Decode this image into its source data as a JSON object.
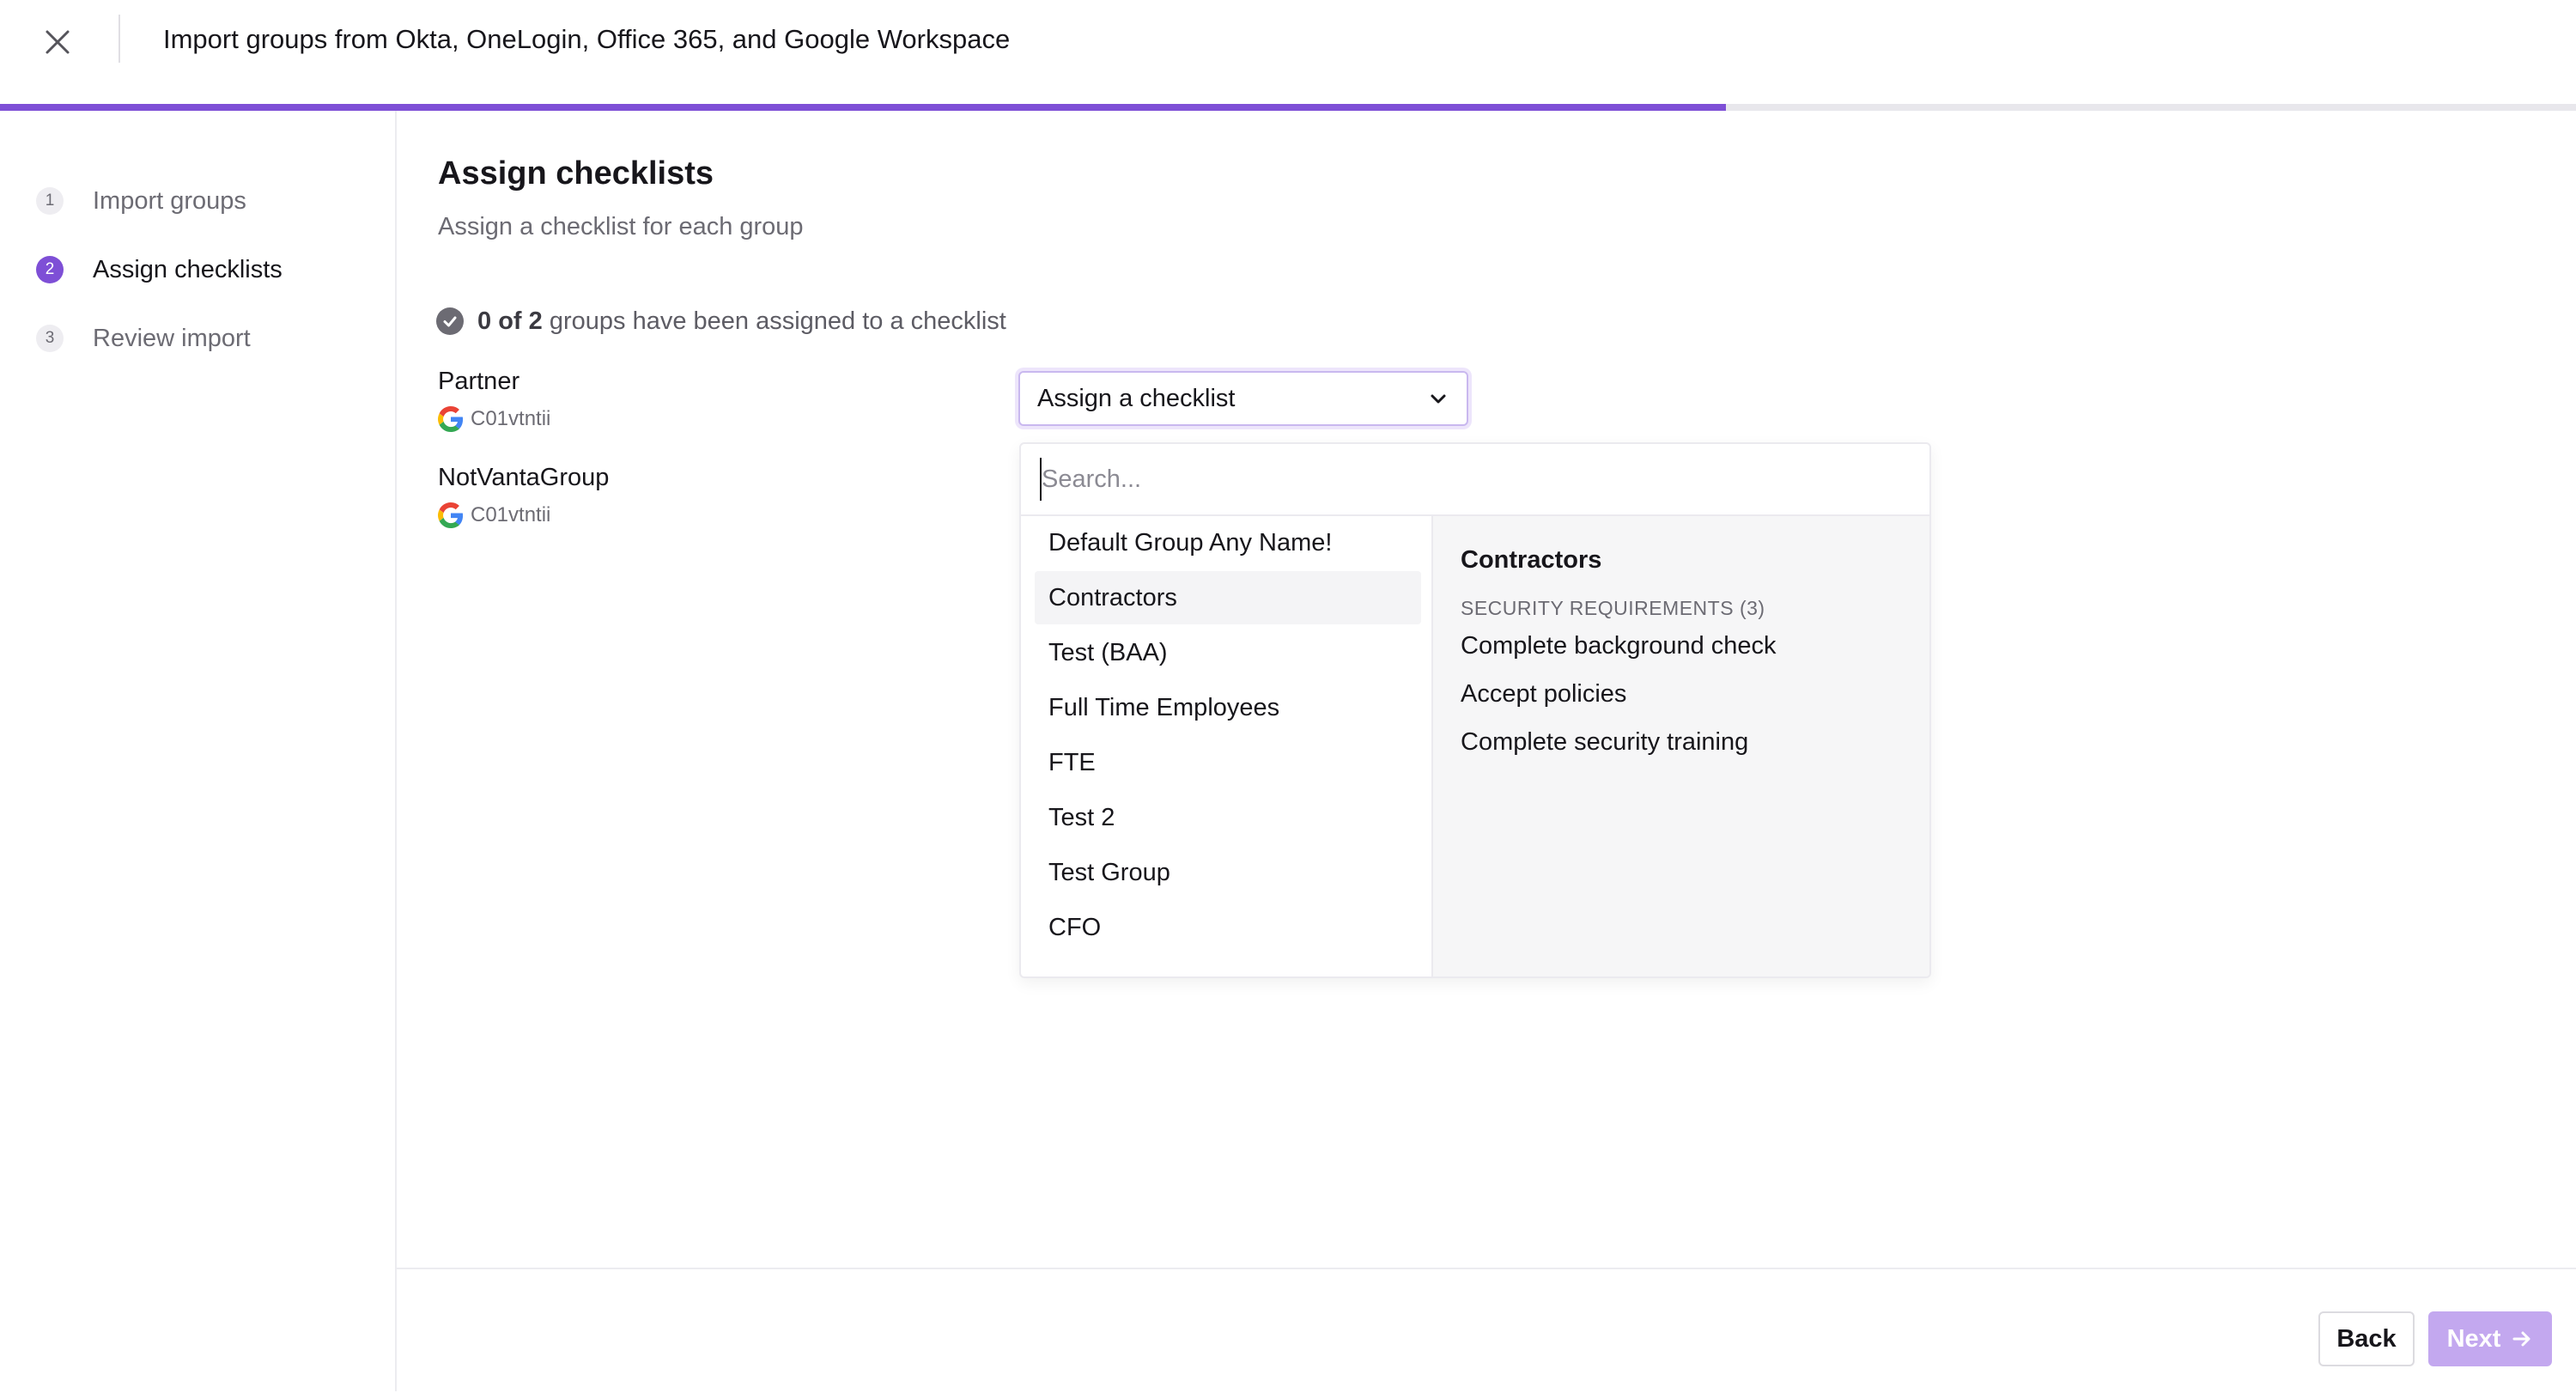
{
  "header": {
    "title": "Import groups from Okta, OneLogin, Office 365, and Google Workspace",
    "close_icon": "close-icon",
    "progress_percent": 67
  },
  "colors": {
    "accent": "#7e4fd6",
    "next_disabled": "#c3a8ef"
  },
  "steps": [
    {
      "number": "1",
      "label": "Import groups",
      "active": false
    },
    {
      "number": "2",
      "label": "Assign checklists",
      "active": true
    },
    {
      "number": "3",
      "label": "Review import",
      "active": false
    }
  ],
  "main": {
    "title": "Assign checklists",
    "subtitle": "Assign a checklist for each group",
    "status": {
      "assigned": "0",
      "of_word": "of",
      "total": "2",
      "suffix": "groups have been assigned to a checklist"
    },
    "groups": [
      {
        "name": "Partner",
        "id": "C01vtntii",
        "provider_icon": "google-icon"
      },
      {
        "name": "NotVantaGroup",
        "id": "C01vtntii",
        "provider_icon": "google-icon"
      }
    ],
    "select": {
      "label": "Assign a checklist",
      "icon": "chevron-down-icon"
    }
  },
  "dropdown": {
    "search_placeholder": "Search...",
    "options": [
      "Default Group Any Name!",
      "Contractors",
      "Test (BAA)",
      "Full Time Employees",
      "FTE",
      "Test 2",
      "Test Group",
      "CFO"
    ],
    "highlighted_option": "Contractors",
    "preview": {
      "title": "Contractors",
      "section_label": "SECURITY REQUIREMENTS (3)",
      "requirements": [
        "Complete background check",
        "Accept policies",
        "Complete security training"
      ]
    }
  },
  "footer": {
    "back_label": "Back",
    "next_label": "Next",
    "next_icon": "arrow-right-icon"
  }
}
